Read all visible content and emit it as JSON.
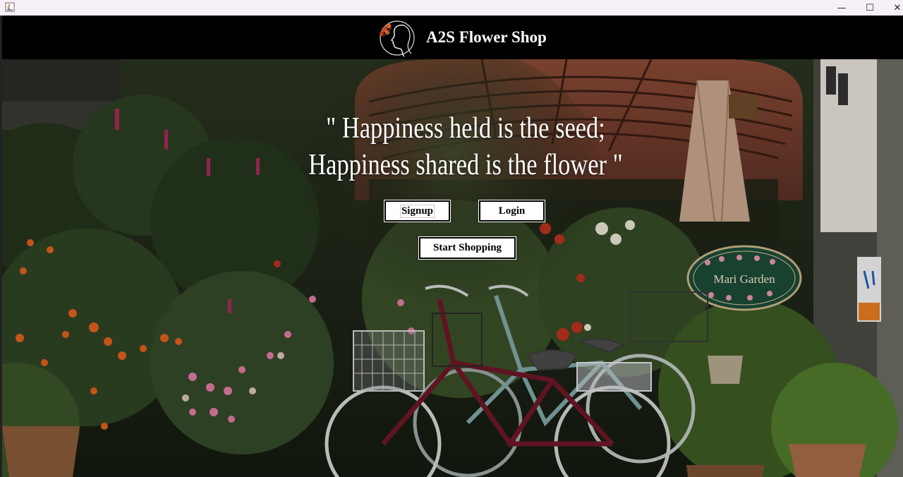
{
  "window": {
    "minimize_glyph": "—",
    "maximize_glyph": "☐",
    "close_glyph": "✕"
  },
  "header": {
    "title": "A2S Flower Shop",
    "logo_icon": "woman-profile-with-flowers-logo"
  },
  "hero": {
    "quote_line1": "\" Happiness held is the seed;",
    "quote_line2": "Happiness shared is the flower \""
  },
  "buttons": {
    "signup_label": "Signup",
    "login_label": "Login",
    "start_shopping_label": "Start Shopping"
  },
  "scene": {
    "sign_text": "Mari Garden"
  },
  "colors": {
    "header_bg": "#000000",
    "button_bg": "#ffffff",
    "text_light": "#ffffff"
  }
}
